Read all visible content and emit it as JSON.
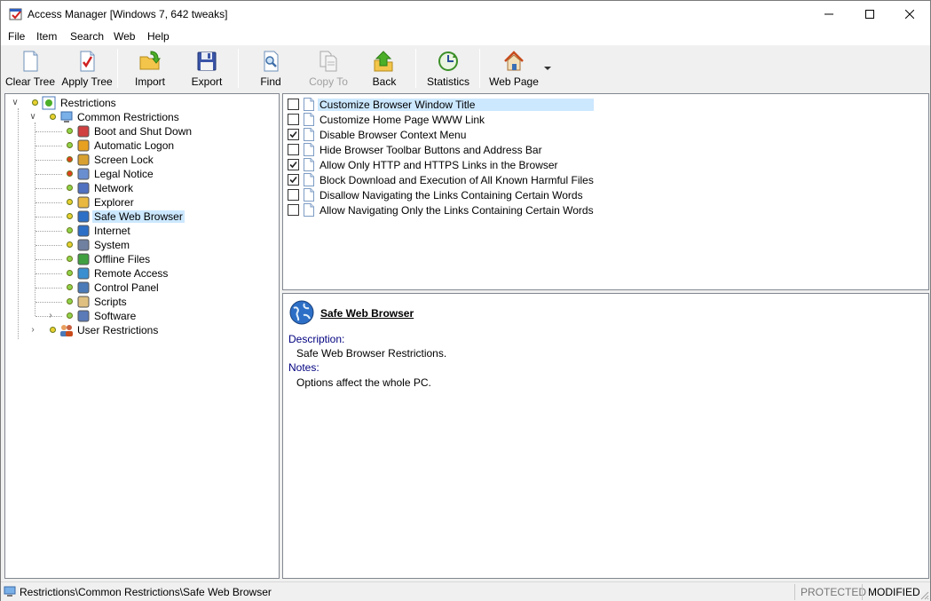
{
  "window": {
    "title": "Access Manager [Windows 7, 642 tweaks]"
  },
  "menu": {
    "items": [
      "File",
      "Item",
      "Search",
      "Web",
      "Help"
    ]
  },
  "toolbar": {
    "buttons": [
      {
        "label": "Clear Tree",
        "icon": "blank-page-icon"
      },
      {
        "label": "Apply Tree",
        "icon": "checked-page-icon"
      },
      {
        "label": "Import",
        "icon": "folder-import-icon"
      },
      {
        "label": "Export",
        "icon": "floppy-disk-icon"
      },
      {
        "label": "Find",
        "icon": "find-page-icon"
      },
      {
        "label": "Copy To",
        "icon": "copy-pages-icon",
        "disabled": true
      },
      {
        "label": "Back",
        "icon": "green-arrow-folder-icon"
      },
      {
        "label": "Statistics",
        "icon": "refresh-chart-icon"
      },
      {
        "label": "Web Page",
        "icon": "home-icon"
      }
    ]
  },
  "tree": {
    "root": "Restrictions",
    "group": "Common Restrictions",
    "children": [
      {
        "label": "Boot and Shut Down",
        "status": "#8fd34a"
      },
      {
        "label": "Automatic Logon",
        "status": "#8fd34a"
      },
      {
        "label": "Screen Lock",
        "status": "#e04020"
      },
      {
        "label": "Legal Notice",
        "status": "#e04020"
      },
      {
        "label": "Network",
        "status": "#8fd34a"
      },
      {
        "label": "Explorer",
        "status": "#e8d030"
      },
      {
        "label": "Safe Web Browser",
        "status": "#e8d030",
        "selected": true
      },
      {
        "label": "Internet",
        "status": "#8fd34a"
      },
      {
        "label": "System",
        "status": "#e8d030"
      },
      {
        "label": "Offline Files",
        "status": "#8fd34a"
      },
      {
        "label": "Remote Access",
        "status": "#8fd34a"
      },
      {
        "label": "Control Panel",
        "status": "#8fd34a"
      },
      {
        "label": "Scripts",
        "status": "#8fd34a"
      },
      {
        "label": "Software",
        "status": "#8fd34a"
      }
    ],
    "user": "User Restrictions"
  },
  "checklist": [
    {
      "label": "Customize Browser Window Title",
      "checked": false
    },
    {
      "label": "Customize Home Page WWW Link",
      "checked": false
    },
    {
      "label": "Disable Browser Context Menu",
      "checked": true
    },
    {
      "label": "Hide Browser Toolbar Buttons and Address Bar",
      "checked": false
    },
    {
      "label": "Allow Only HTTP and HTTPS Links in the Browser",
      "checked": true
    },
    {
      "label": "Block Download and Execution of All Known Harmful Files",
      "checked": true
    },
    {
      "label": "Disallow Navigating the Links Containing Certain Words",
      "checked": false
    },
    {
      "label": "Allow Navigating Only the Links Containing Certain Words",
      "checked": false
    }
  ],
  "details": {
    "title": "Safe Web Browser",
    "description_label": "Description:",
    "description": "Safe Web Browser Restrictions.",
    "notes_label": "Notes:",
    "notes": "Options affect the whole PC."
  },
  "status": {
    "path": "Restrictions\\Common Restrictions\\Safe Web Browser",
    "protected": "PROTECTED",
    "modified": "MODIFIED"
  },
  "colors": {
    "selection": "#cce8ff",
    "accent": "#0078d7"
  }
}
